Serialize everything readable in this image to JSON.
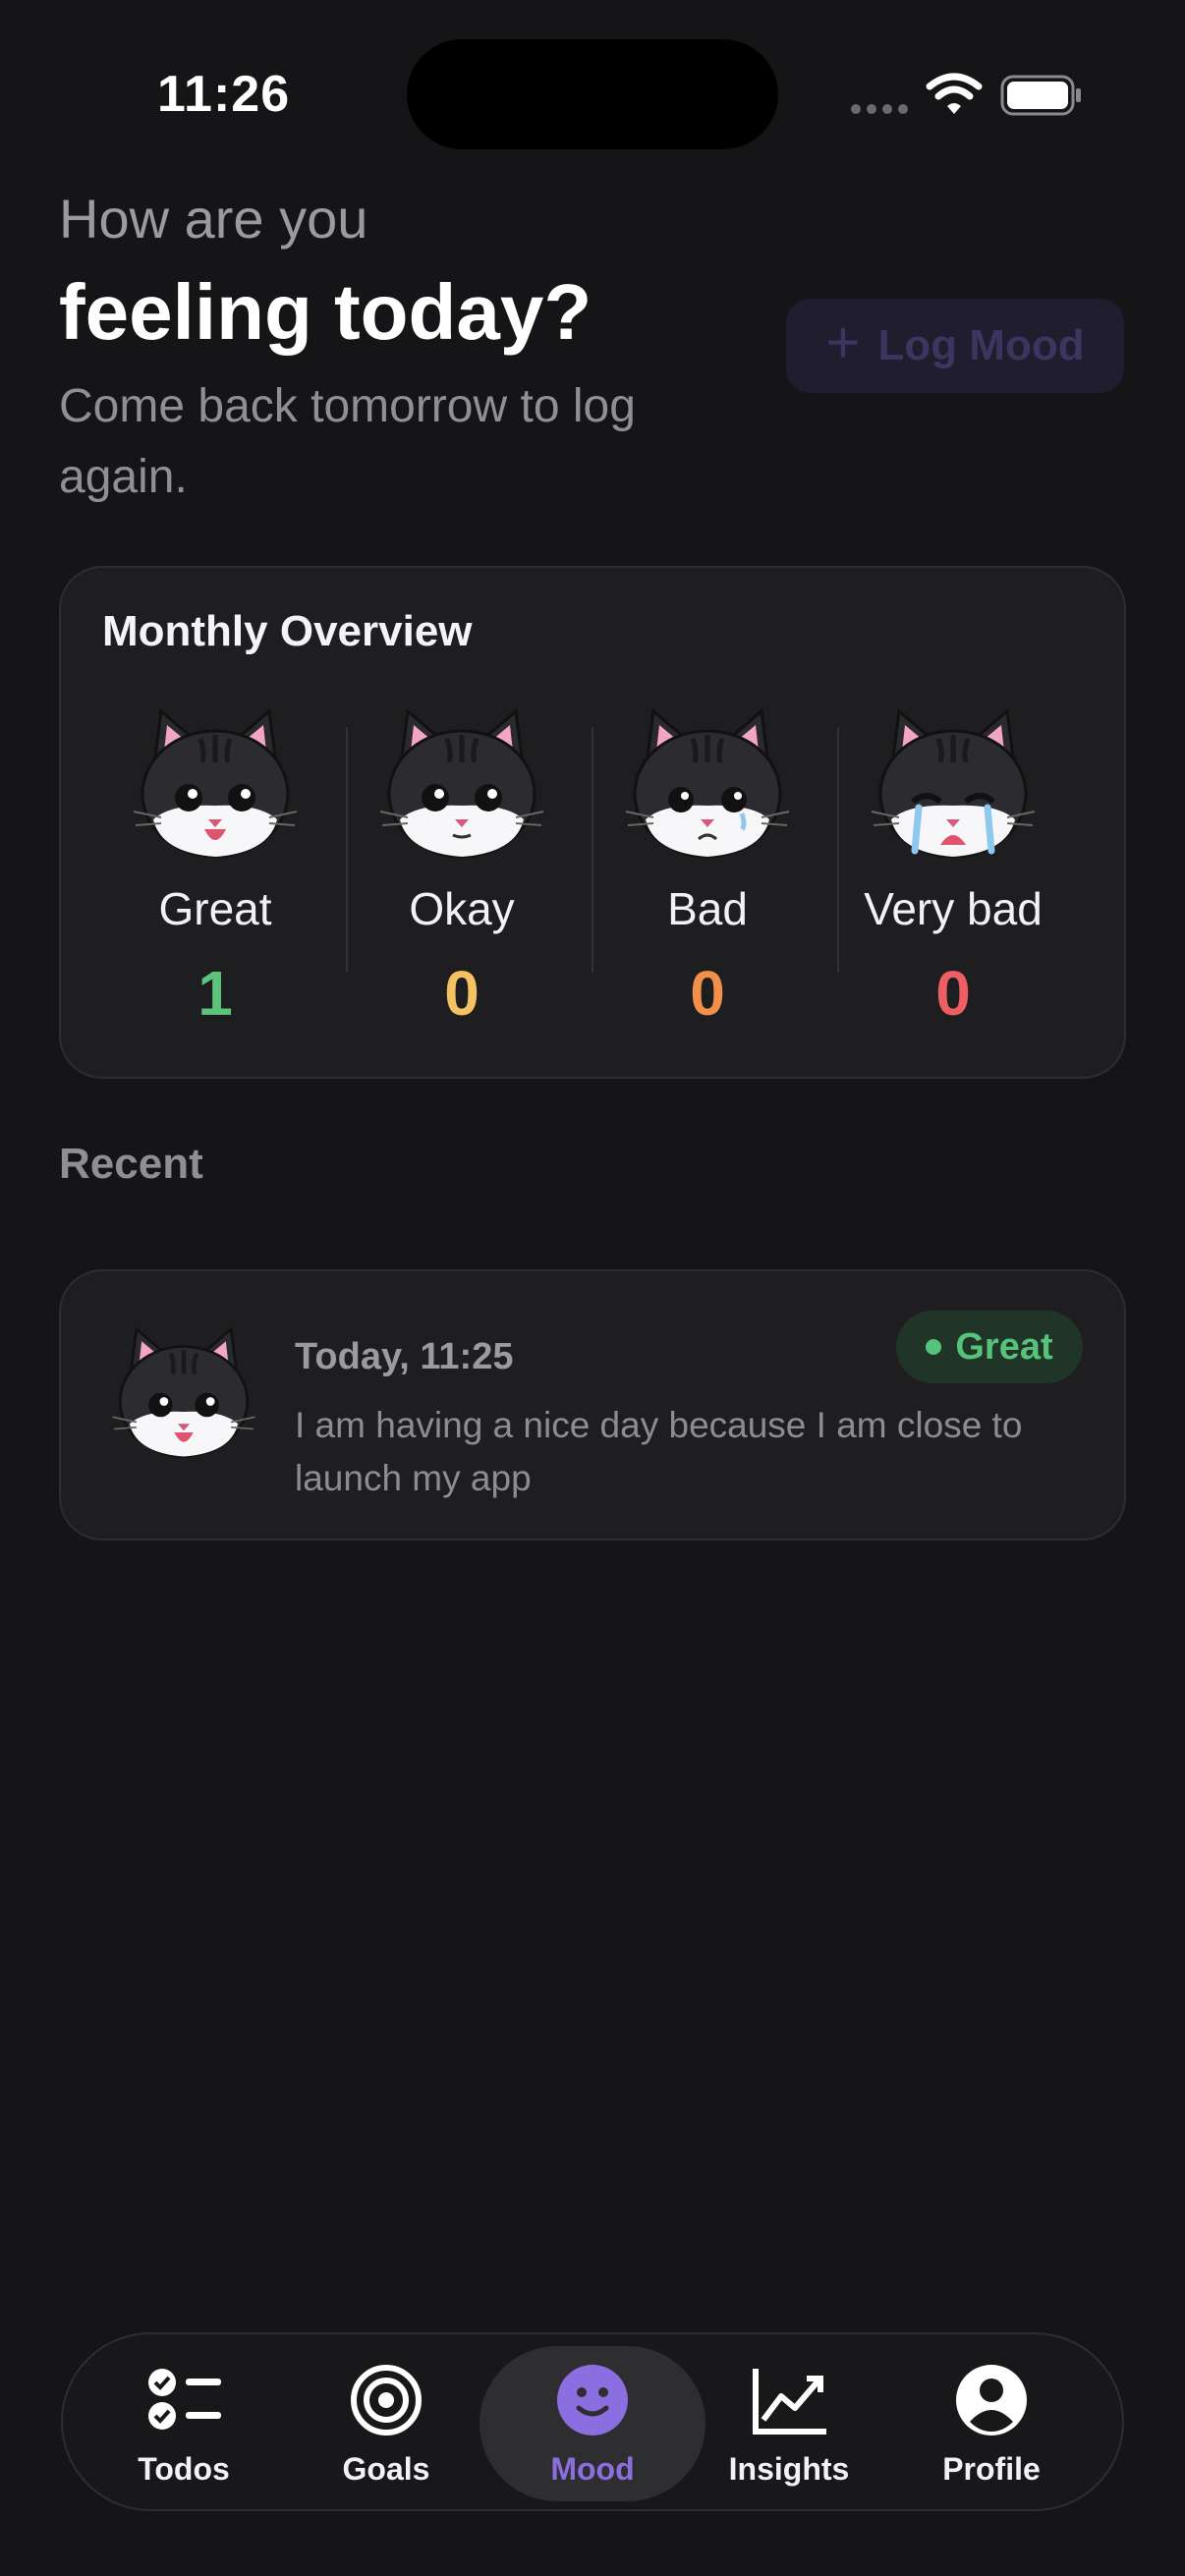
{
  "status_bar": {
    "time": "11:26"
  },
  "header": {
    "greeting_line1": "How are you",
    "greeting_line2": "feeling today?",
    "subtitle": "Come back tomorrow to log again.",
    "log_button_label": "Log Mood"
  },
  "overview": {
    "title": "Monthly Overview",
    "moods": [
      {
        "label": "Great",
        "count": "1",
        "color": "#5cc37b"
      },
      {
        "label": "Okay",
        "count": "0",
        "color": "#f5c263"
      },
      {
        "label": "Bad",
        "count": "0",
        "color": "#f28f4a"
      },
      {
        "label": "Very bad",
        "count": "0",
        "color": "#ee5f63"
      }
    ]
  },
  "recent": {
    "title": "Recent",
    "entries": [
      {
        "date": "Today, 11:25",
        "mood": "Great",
        "note": "I am having a nice day because I am close to launch my app"
      }
    ]
  },
  "tabbar": {
    "tabs": [
      {
        "label": "Todos",
        "icon": "checklist-icon"
      },
      {
        "label": "Goals",
        "icon": "target-icon"
      },
      {
        "label": "Mood",
        "icon": "smiley-icon",
        "active": true
      },
      {
        "label": "Insights",
        "icon": "chart-icon"
      },
      {
        "label": "Profile",
        "icon": "person-icon"
      }
    ]
  },
  "colors": {
    "accent": "#8b6fe0",
    "background": "#151517",
    "card": "#1e1e20"
  }
}
